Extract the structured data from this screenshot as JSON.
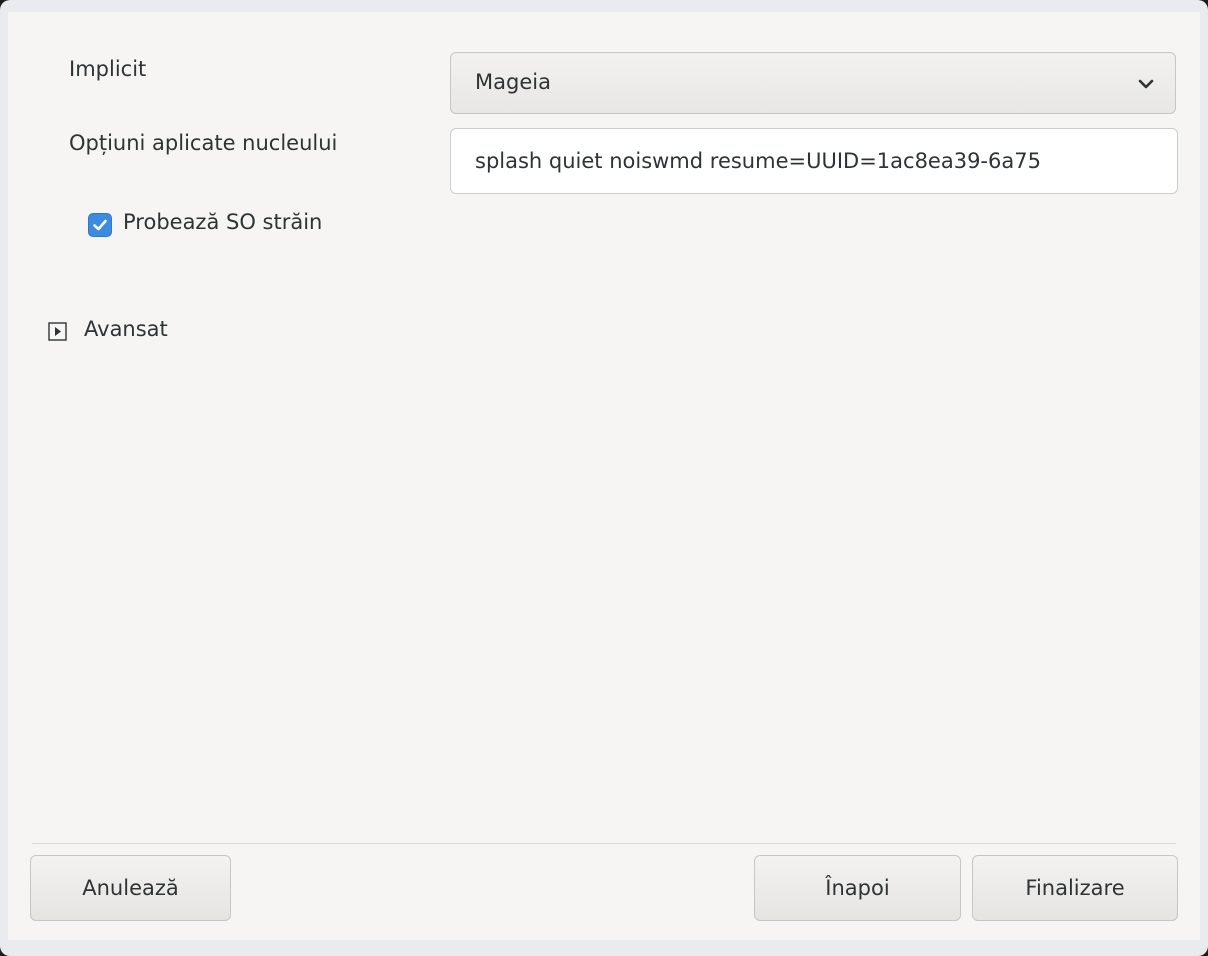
{
  "form": {
    "default_label": "Implicit",
    "default_value": "Mageia",
    "kernel_options_label": "Opțiuni aplicate nucleului",
    "kernel_options_value": "splash quiet noiswmd resume=UUID=1ac8ea39-6a75",
    "probe_foreign_os_label": "Probează SO străin",
    "probe_foreign_os_checked": true,
    "advanced_label": "Avansat"
  },
  "buttons": {
    "cancel": "Anulează",
    "back": "Înapoi",
    "finish": "Finalizare"
  },
  "colors": {
    "accent": "#3d8be0",
    "window_bg": "#f6f5f4"
  },
  "icons": {
    "combo": "chevron-down-icon",
    "checkbox": "checkmark-icon",
    "expander": "triangle-right-icon"
  }
}
